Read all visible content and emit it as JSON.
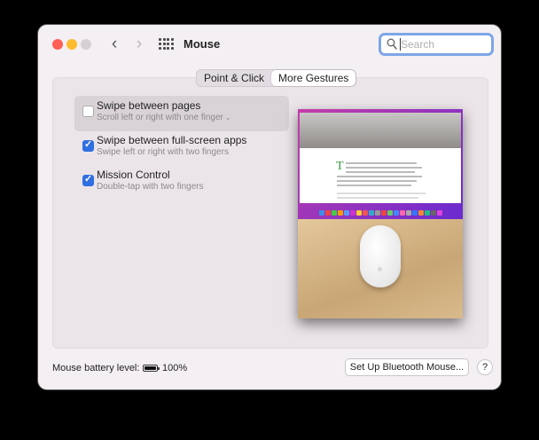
{
  "window": {
    "title": "Mouse"
  },
  "toolbar": {
    "back_icon": "chevron-left-icon",
    "forward_icon": "chevron-right-icon",
    "grid_icon": "show-all-grid-icon"
  },
  "search": {
    "placeholder": "Search",
    "icon": "magnifier-icon"
  },
  "tabs": [
    {
      "label": "Point & Click",
      "active": false
    },
    {
      "label": "More Gestures",
      "active": true
    }
  ],
  "options": [
    {
      "title": "Swipe between pages",
      "subtitle": "Scroll left or right with one finger",
      "checked": false,
      "has_dropdown": true,
      "selected": true
    },
    {
      "title": "Swipe between full-screen apps",
      "subtitle": "Swipe left or right with two fingers",
      "checked": true,
      "has_dropdown": false,
      "selected": false
    },
    {
      "title": "Mission Control",
      "subtitle": "Double-tap with two fingers",
      "checked": true,
      "has_dropdown": false,
      "selected": false
    }
  ],
  "footer": {
    "battery_label": "Mouse battery level:",
    "battery_percent": "100%",
    "battery_level": 1.0,
    "bluetooth_button": "Set Up Bluetooth Mouse...",
    "help_button": "?"
  },
  "colors": {
    "checkbox_accent": "#2f6fe1",
    "search_focus": "#7ea6e6",
    "close": "#fe5f57",
    "minimize": "#febc2e"
  }
}
